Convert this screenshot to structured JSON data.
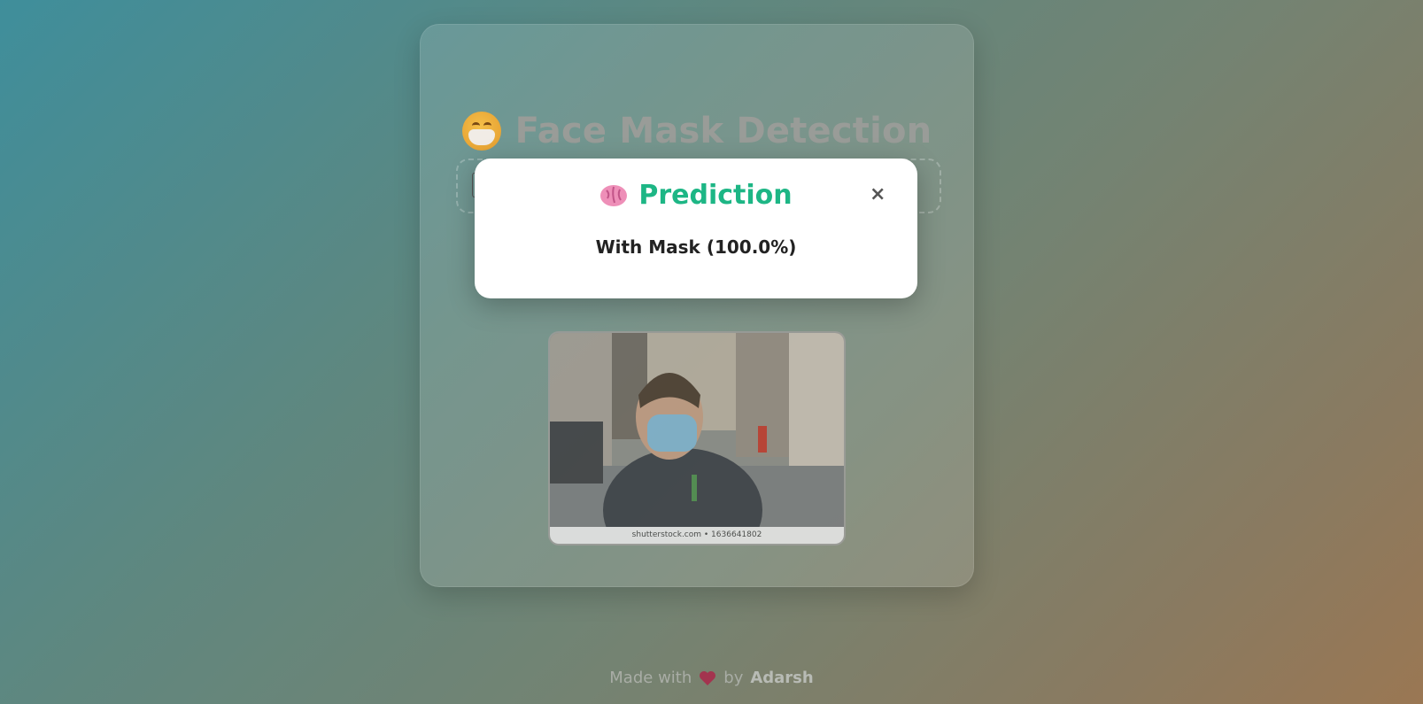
{
  "app": {
    "title": "Face Mask Detection",
    "title_icon": "mask-face-emoji"
  },
  "upload": {
    "file_input_icon": "file-chooser-icon"
  },
  "preview": {
    "image_alt": "man wearing face mask",
    "watermark": "shutterstock.com • 1636641802"
  },
  "modal": {
    "icon": "brain-icon",
    "title": "Prediction",
    "close_label": "×",
    "result": "With Mask (100.0%)"
  },
  "footer": {
    "made_with": "Made with",
    "by": "by",
    "author": "Adarsh",
    "heart_icon": "heart-icon"
  },
  "colors": {
    "accent": "#1db685",
    "title_gray": "#999c98"
  }
}
